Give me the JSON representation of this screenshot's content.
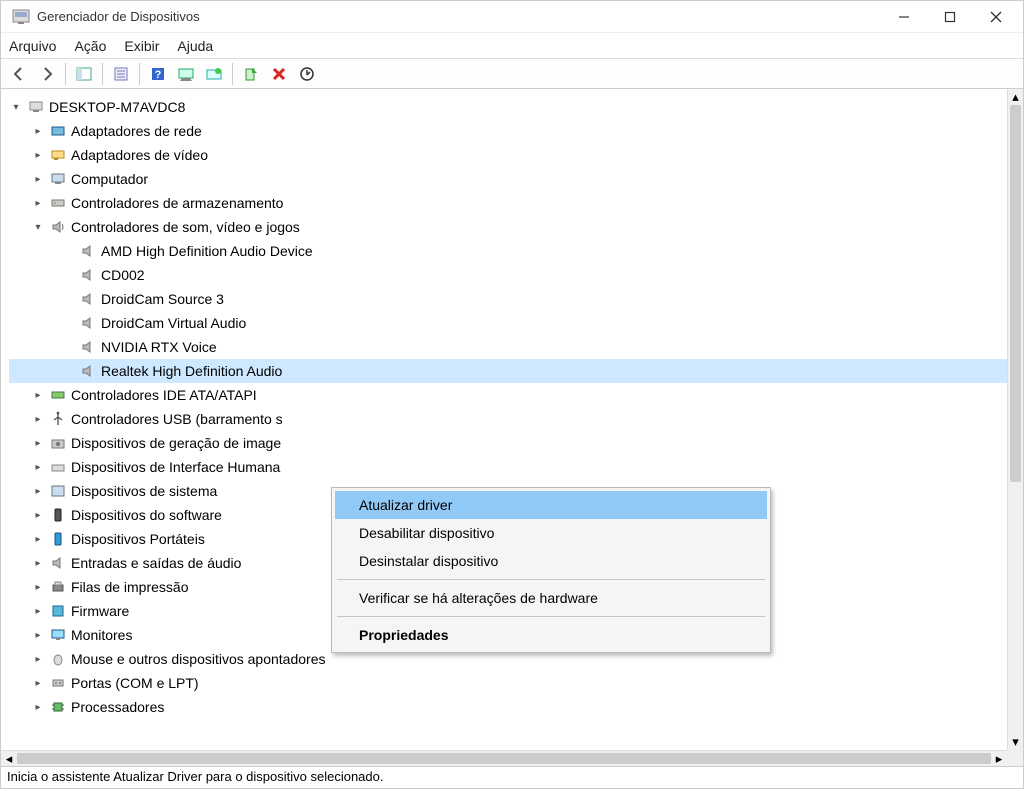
{
  "window": {
    "title": "Gerenciador de Dispositivos"
  },
  "menu": {
    "file": "Arquivo",
    "action": "Ação",
    "view": "Exibir",
    "help": "Ajuda"
  },
  "tree": {
    "root": "DESKTOP-M7AVDC8",
    "network_adapters": "Adaptadores de rede",
    "display_adapters": "Adaptadores de vídeo",
    "computer": "Computador",
    "storage_controllers": "Controladores de armazenamento",
    "sound_controllers": "Controladores de som, vídeo e jogos",
    "sound_children": {
      "amd": "AMD High Definition Audio Device",
      "cd002": "CD002",
      "droidcam_src": "DroidCam Source 3",
      "droidcam_va": "DroidCam Virtual Audio",
      "nvidia_rtx": "NVIDIA RTX Voice",
      "realtek": "Realtek High Definition Audio"
    },
    "ide": "Controladores IDE ATA/ATAPI",
    "usb": "Controladores USB (barramento s",
    "imaging": "Dispositivos de geração de image",
    "hid": "Dispositivos de Interface Humana",
    "system": "Dispositivos de sistema",
    "software": "Dispositivos do software",
    "portable": "Dispositivos Portáteis",
    "audio_io": "Entradas e saídas de áudio",
    "print_queues": "Filas de impressão",
    "firmware": "Firmware",
    "monitors": "Monitores",
    "mice": "Mouse e outros dispositivos apontadores",
    "ports": "Portas (COM e LPT)",
    "processors": "Processadores"
  },
  "context_menu": {
    "update_driver": "Atualizar driver",
    "disable_device": "Desabilitar dispositivo",
    "uninstall_device": "Desinstalar dispositivo",
    "scan_hardware": "Verificar se há alterações de hardware",
    "properties": "Propriedades"
  },
  "status_bar": "Inicia o assistente Atualizar Driver para o dispositivo selecionado."
}
